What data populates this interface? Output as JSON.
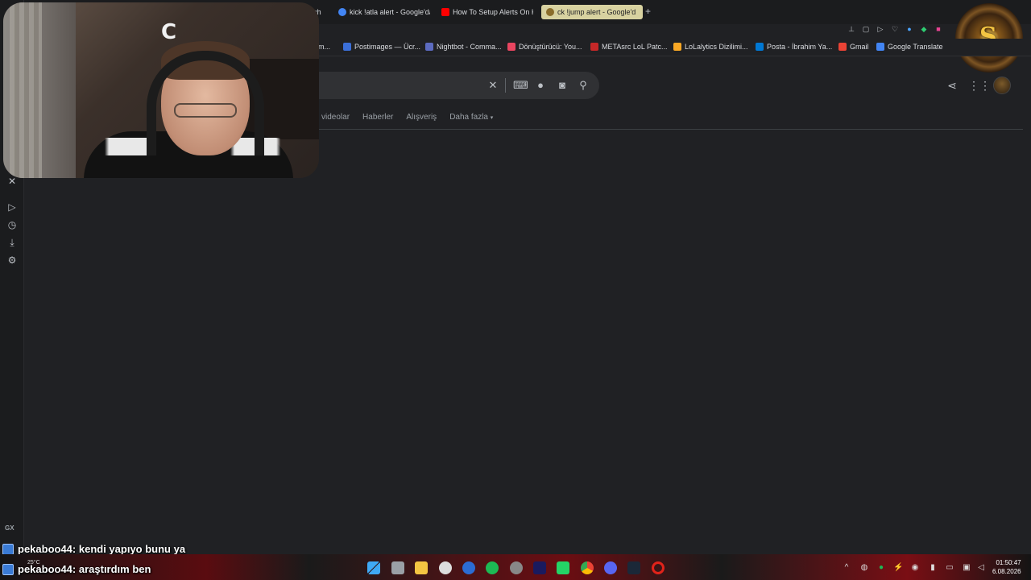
{
  "tabs": [
    {
      "label": "m - Watch",
      "favicon_color": "#202124"
    },
    {
      "label": "kick !atla alert - Google'da",
      "favicon_color": "#4285f4"
    },
    {
      "label": "How To Setup Alerts On Ki",
      "favicon_color": "#ff0000"
    },
    {
      "label": "ck !jump alert - Google'd",
      "favicon_color": "#8a6d2b",
      "active": true
    }
  ],
  "new_tab_label": "+",
  "bookmarks": [
    {
      "label": "am...",
      "color": "#444"
    },
    {
      "label": "Postimages — Ücr...",
      "color": "#3b6fd8"
    },
    {
      "label": "Nightbot - Comma...",
      "color": "#5c6bc0"
    },
    {
      "label": "Dönüştürücü: You...",
      "color": "#e94560"
    },
    {
      "label": "METAsrc LoL Patc...",
      "color": "#c62828"
    },
    {
      "label": "LoLalytics Dizilimi...",
      "color": "#f9a825"
    },
    {
      "label": "Posta - İbrahim Ya...",
      "color": "#0078d4"
    },
    {
      "label": "Gmail",
      "color": "#ea4335"
    },
    {
      "label": "Google Translate",
      "color": "#4285f4"
    }
  ],
  "search": {
    "clear_icon": "close-icon",
    "keyboard_icon": "keyboard-icon",
    "mic_icon": "mic-icon",
    "lens_icon": "lens-icon",
    "search_icon": "search-icon"
  },
  "nav_tabs": [
    "videolar",
    "Haberler",
    "Alışveriş",
    "Daha fazla"
  ],
  "webcam": {
    "overlay_letter": "C"
  },
  "chat": [
    {
      "user": "pekaboo44",
      "message": " : kendi yapıyo bunu ya"
    },
    {
      "user": "pekaboo44",
      "message": " : araştırdım ben"
    }
  ],
  "sidebar_label": "GX",
  "taskbar": {
    "weather": "25°C",
    "time": "01:50:47",
    "date": "6.08.2026"
  }
}
